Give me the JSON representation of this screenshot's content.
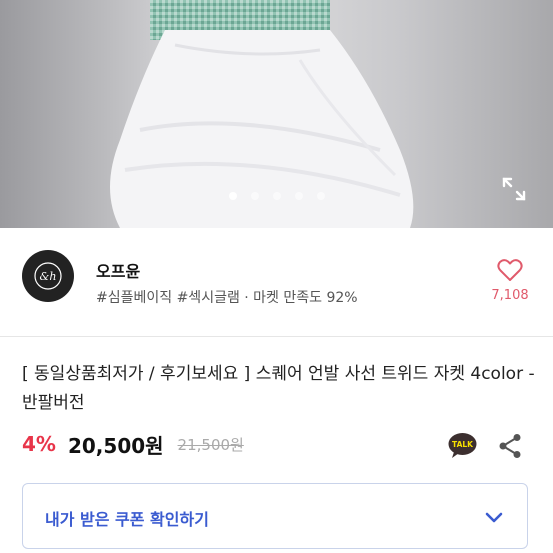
{
  "gallery": {
    "dot_count": 5,
    "active_dot_index": 0,
    "expand_icon": "expand-icon"
  },
  "seller": {
    "name": "오프윤",
    "tags": "#심플베이직 #섹시글램 · 마켓 만족도 92%",
    "logo_icon": "brand-logo",
    "like_count": "7,108",
    "like_icon": "heart-icon"
  },
  "product": {
    "title": "[ 동일상품최저가 / 후기보세요 ] 스퀘어 언발 사선 트위드 자켓 4color - 반팔버전",
    "discount": "4%",
    "price": "20,500원",
    "original_price": "21,500원",
    "talk_label": "TALK",
    "share_icon": "share-icon"
  },
  "coupon": {
    "label": "내가 받은 쿠폰 확인하기",
    "chevron_icon": "chevron-down-icon"
  },
  "colors": {
    "discount": "#e8354a",
    "coupon_text": "#3a5bd0",
    "like": "#e05a6b",
    "talk_bg": "#3c2f2f",
    "talk_text": "#f7e000"
  }
}
